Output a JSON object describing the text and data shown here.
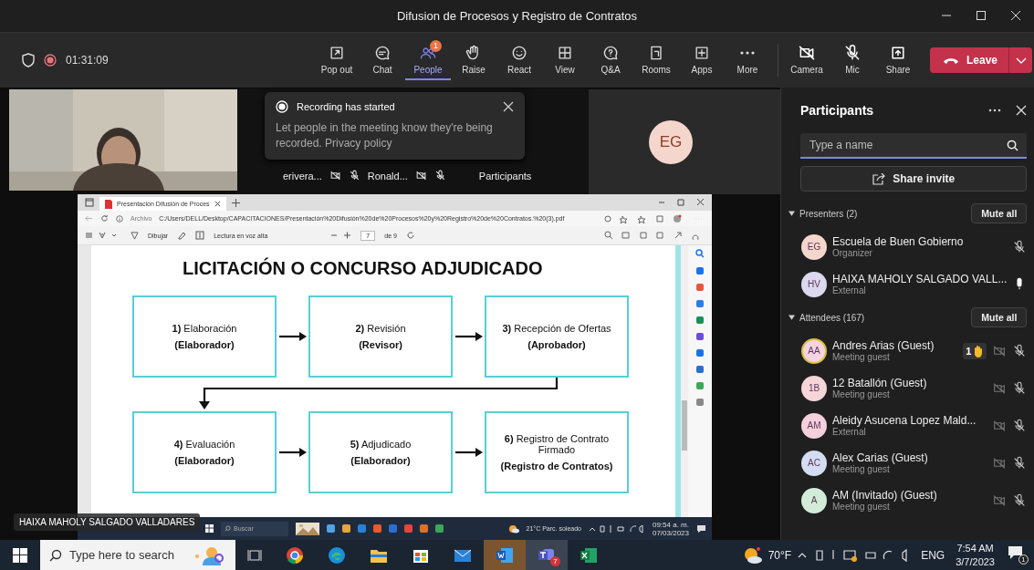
{
  "window": {
    "title": "Difusion de Procesos y Registro de Contratos"
  },
  "meeting_bar": {
    "timer": "01:31:09",
    "recording": true,
    "tools": [
      {
        "label": "Pop out",
        "selected": false
      },
      {
        "label": "Chat",
        "selected": false
      },
      {
        "label": "People",
        "selected": true,
        "badge": "1"
      },
      {
        "label": "Raise",
        "selected": false
      },
      {
        "label": "React",
        "selected": false
      },
      {
        "label": "View",
        "selected": false
      },
      {
        "label": "Q&A",
        "selected": false
      },
      {
        "label": "Rooms",
        "selected": false
      },
      {
        "label": "Apps",
        "selected": false
      },
      {
        "label": "More",
        "selected": false
      }
    ],
    "devices": [
      {
        "label": "Camera"
      },
      {
        "label": "Mic"
      },
      {
        "label": "Share"
      }
    ],
    "leave": "Leave"
  },
  "toast": {
    "title": "Recording has started",
    "message": "Let people in the meeting know they're being recorded. Privacy policy"
  },
  "video_strip": {
    "tiles": [
      {
        "name": "erivera...",
        "camera_off": true,
        "muted": true
      },
      {
        "name": "Ronald...",
        "camera_off": true,
        "muted": true
      }
    ],
    "more_label": "Participants",
    "avatar_tile": {
      "initials": "EG"
    }
  },
  "shared_screen": {
    "browser": {
      "tab": "Presentación Difusión de Proces",
      "file_label": "Archivo",
      "url": "C:/Users/DELL/Desktop/CAPACITACIONES/Presentación%20Difusión%20de%20Procesos%20y%20Registro%20de%20Contratos.%20(3).pdf"
    },
    "pdf_toolbar": {
      "draw": "Dibujar",
      "read_aloud": "Lectura en voz alta",
      "page": "7",
      "page_count": "de 9"
    },
    "slide": {
      "title": "LICITACIÓN O CONCURSO ADJUDICADO",
      "steps": [
        {
          "title": "**1)** Elaboración",
          "role": "(Elaborador)"
        },
        {
          "title": "**2)** Revisión",
          "role": "(Revisor)"
        },
        {
          "title": "**3)** Recepción de Ofertas",
          "role": "(Aprobador)"
        },
        {
          "title": "**4)** Evaluación",
          "role": "(Elaborador)"
        },
        {
          "title": "**5)** Adjudicado",
          "role": "(Elaborador)"
        },
        {
          "title": "**6)** Registro de Contrato Firmado",
          "role": "(Registro de Contratos)"
        }
      ]
    },
    "presenter_name": "HAIXA MAHOLY SALGADO VALLADARES",
    "taskbar": {
      "search": "Buscar",
      "weather": "21°C Parc. soleado",
      "time": "09:54 a. m.",
      "date": "07/03/2023"
    }
  },
  "participants_panel": {
    "title": "Participants",
    "search": {
      "placeholder": "Type a name"
    },
    "share_invite": "Share invite",
    "sections": [
      {
        "title": "Presenters (2)",
        "expanded": true,
        "action": "Mute all",
        "people": [
          {
            "initials": "EG",
            "color": "#f4d6cc",
            "name": "Escuela de Buen Gobierno",
            "role": "Organizer",
            "muted": true
          },
          {
            "initials": "HV",
            "color": "#dcd8f0",
            "name": "HAIXA MAHOLY SALGADO VALL...",
            "role": "External",
            "muted": false
          }
        ]
      },
      {
        "title": "Attendees (167)",
        "expanded": true,
        "action": "Mute all",
        "people": [
          {
            "initials": "AA",
            "color": "#f4d4e0",
            "name": "Andres Arias (Guest)",
            "role": "Meeting guest",
            "muted": true,
            "camera_off": true,
            "raised_hand": "1"
          },
          {
            "initials": "1B",
            "color": "#f6d5d8",
            "name": "12 Batallón (Guest)",
            "role": "Meeting guest",
            "muted": true,
            "camera_off": true
          },
          {
            "initials": "AM",
            "color": "#f4d0dc",
            "name": "Aleidy Asucena Lopez Mald...",
            "role": "External",
            "muted": true,
            "camera_off": true
          },
          {
            "initials": "AC",
            "color": "#d3dcf2",
            "name": "Alex Carias (Guest)",
            "role": "Meeting guest",
            "muted": true,
            "camera_off": true
          },
          {
            "initials": "A",
            "color": "#d2ecd9",
            "name": "AM (Invitado) (Guest)",
            "role": "Meeting guest",
            "muted": true,
            "camera_off": true
          }
        ]
      }
    ]
  },
  "taskbar": {
    "search": {
      "placeholder": "Type here to search"
    },
    "teams_badge": "7",
    "temperature": "70°F",
    "language": "ENG",
    "time": "7:54 AM",
    "date": "3/7/2023",
    "notifications": "1"
  }
}
